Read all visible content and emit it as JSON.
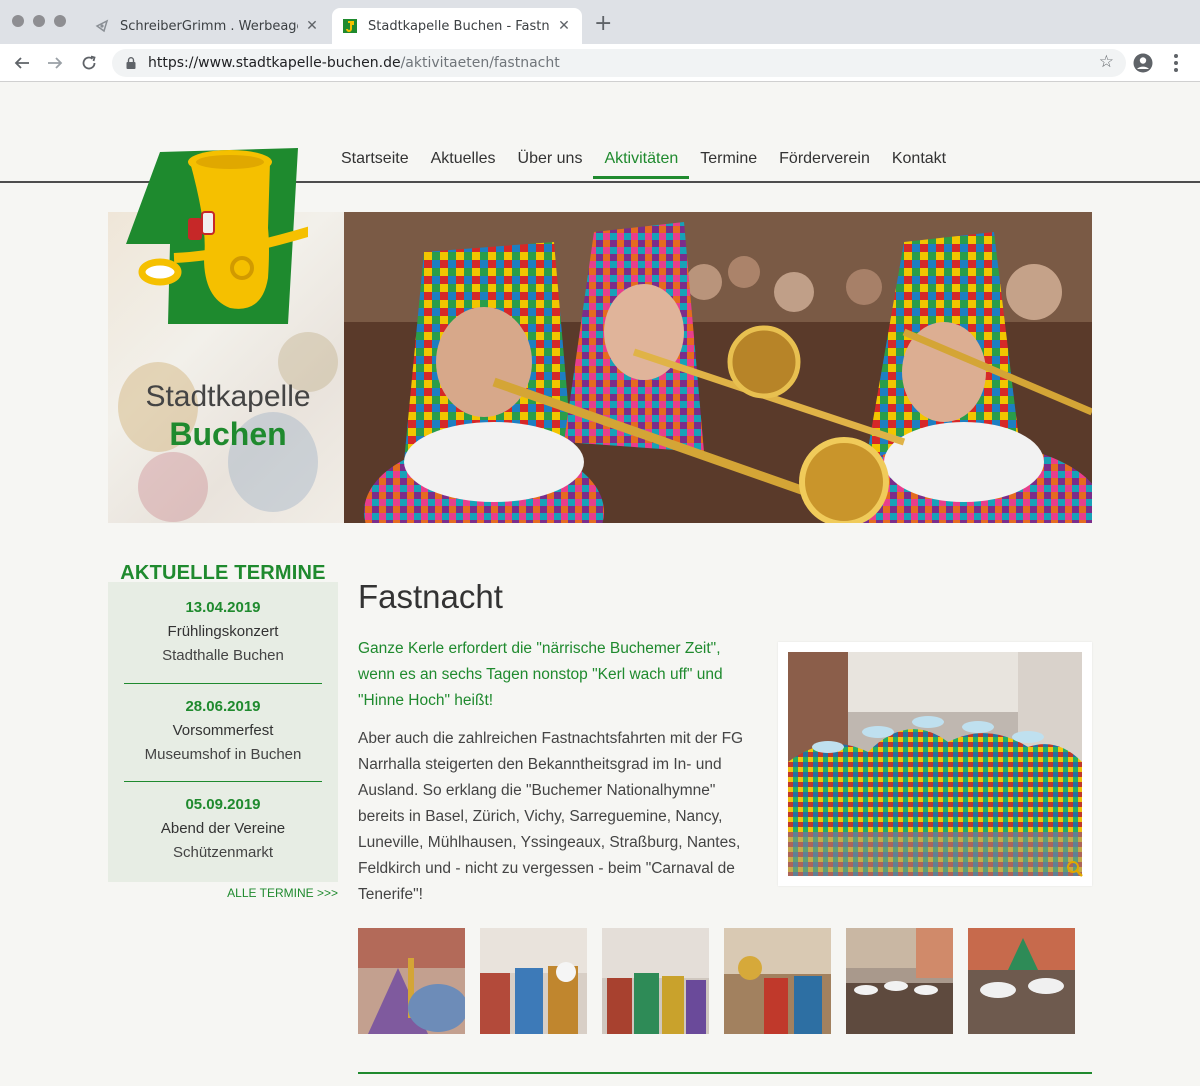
{
  "browser": {
    "tabs": [
      {
        "title": "SchreiberGrimm . Werbeagentur",
        "active": false
      },
      {
        "title": "Stadtkapelle Buchen - Fastnacht",
        "active": true
      }
    ],
    "url_host": "https://www.stadtkapelle-buchen.de",
    "url_path": "/aktivitaeten/fastnacht",
    "icons": [
      "back-icon",
      "forward-icon",
      "reload-icon",
      "lock-icon",
      "star-icon",
      "profile-icon",
      "menu-icon",
      "new-tab-icon"
    ]
  },
  "site": {
    "nav": [
      {
        "label": "Startseite",
        "current": false
      },
      {
        "label": "Aktuelles",
        "current": false
      },
      {
        "label": "Über uns",
        "current": false
      },
      {
        "label": "Aktivitäten",
        "current": true
      },
      {
        "label": "Termine",
        "current": false
      },
      {
        "label": "Förderverein",
        "current": false
      },
      {
        "label": "Kontakt",
        "current": false
      }
    ],
    "brand_line1": "Stadtkapelle",
    "brand_line2": "Buchen",
    "colors": {
      "accent": "#1f8a2e",
      "logo_yellow": "#f5c000",
      "text": "#333333",
      "background": "#f6f6f3"
    }
  },
  "sidebar": {
    "heading": "AKTUELLE TERMINE",
    "events": [
      {
        "date": "13.04.2019",
        "name": "Frühlingskonzert",
        "place": "Stadthalle Buchen"
      },
      {
        "date": "28.06.2019",
        "name": "Vorsommerfest",
        "place": "Museumshof in Buchen"
      },
      {
        "date": "05.09.2019",
        "name": "Abend der Vereine",
        "place": "Schützenmarkt"
      }
    ],
    "all_link": "ALLE TERMINE >>>"
  },
  "content": {
    "title": "Fastnacht",
    "lead_lines": [
      "Ganze Kerle erfordert die \"närrische Buchemer Zeit\",",
      "wenn es an sechs Tagen nonstop \"Kerl wach uff\" und",
      "\"Hinne Hoch\" heißt!"
    ],
    "body_lines": [
      "Aber auch die zahlreichen Fastnachtsfahrten mit der FG",
      "Narrhalla steigerten den Bekanntheitsgrad im In- und",
      "Ausland. So erklang die \"Buchemer Nationalhymne\"",
      "bereits in Basel, Zürich, Vichy, Sarreguemine, Nancy,",
      "Luneville, Mühlhausen, Yssingeaux, Straßburg, Nantes,",
      "Feldkirch und - nicht zu vergessen - beim \"Carnaval de",
      "Tenerife\"!"
    ],
    "thumbnail_count": 6
  }
}
